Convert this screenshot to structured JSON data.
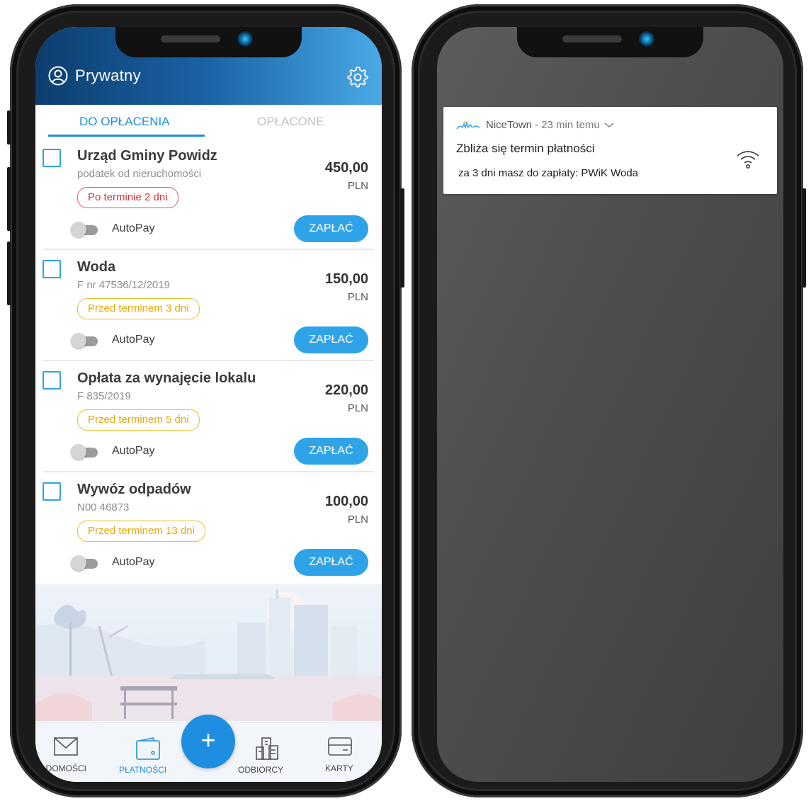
{
  "left_app": {
    "header": {
      "profile_name": "Prywatny"
    },
    "tabs": [
      {
        "label": "DO OPŁACENIA",
        "active": true
      },
      {
        "label": "OPŁACONE",
        "active": false
      }
    ],
    "bills": [
      {
        "title": "Urząd Gminy Powidz",
        "subtitle": "podatek od nieruchomości",
        "badge": "Po terminie 2 dni",
        "badge_status": "late",
        "amount": "450,00",
        "currency": "PLN",
        "autopay_label": "AutoPay",
        "autopay_on": false,
        "pay_label": "ZAPŁAĆ"
      },
      {
        "title": "Woda",
        "subtitle": "F nr 47536/12/2019",
        "badge": "Przed terminem 3 dni",
        "badge_status": "soon",
        "amount": "150,00",
        "currency": "PLN",
        "autopay_label": "AutoPay",
        "autopay_on": false,
        "pay_label": "ZAPŁAĆ"
      },
      {
        "title": "Opłata za wynajęcie lokalu",
        "subtitle": "F 835/2019",
        "badge": "Przed terminem 5 dni",
        "badge_status": "soon",
        "amount": "220,00",
        "currency": "PLN",
        "autopay_label": "AutoPay",
        "autopay_on": false,
        "pay_label": "ZAPŁAĆ"
      },
      {
        "title": "Wywóz odpadów",
        "subtitle": "N00 46873",
        "badge": "Przed terminem 13 dni",
        "badge_status": "soon",
        "amount": "100,00",
        "currency": "PLN",
        "autopay_label": "AutoPay",
        "autopay_on": false,
        "pay_label": "ZAPŁAĆ"
      }
    ],
    "bottom_nav": {
      "items": [
        {
          "label": "WIADOMOŚCI",
          "icon": "envelope-icon",
          "active": false
        },
        {
          "label": "PŁATNOŚCI",
          "icon": "wallet-icon",
          "active": true
        },
        {
          "label": "ODBIORCY",
          "icon": "buildings-icon",
          "active": false
        },
        {
          "label": "KARTY",
          "icon": "card-icon",
          "active": false
        }
      ],
      "fab_symbol": "+"
    },
    "colors": {
      "accent": "#1e8fe0",
      "late": "#d93535",
      "soon": "#eaa90e"
    }
  },
  "right_notification": {
    "app_name": "NiceTown",
    "time_text": "- 23 min temu",
    "title": "Zbliża się termin płatności",
    "body": "za 3 dni masz do zapłaty: PWiK Woda",
    "icon": "wifi-icon"
  }
}
